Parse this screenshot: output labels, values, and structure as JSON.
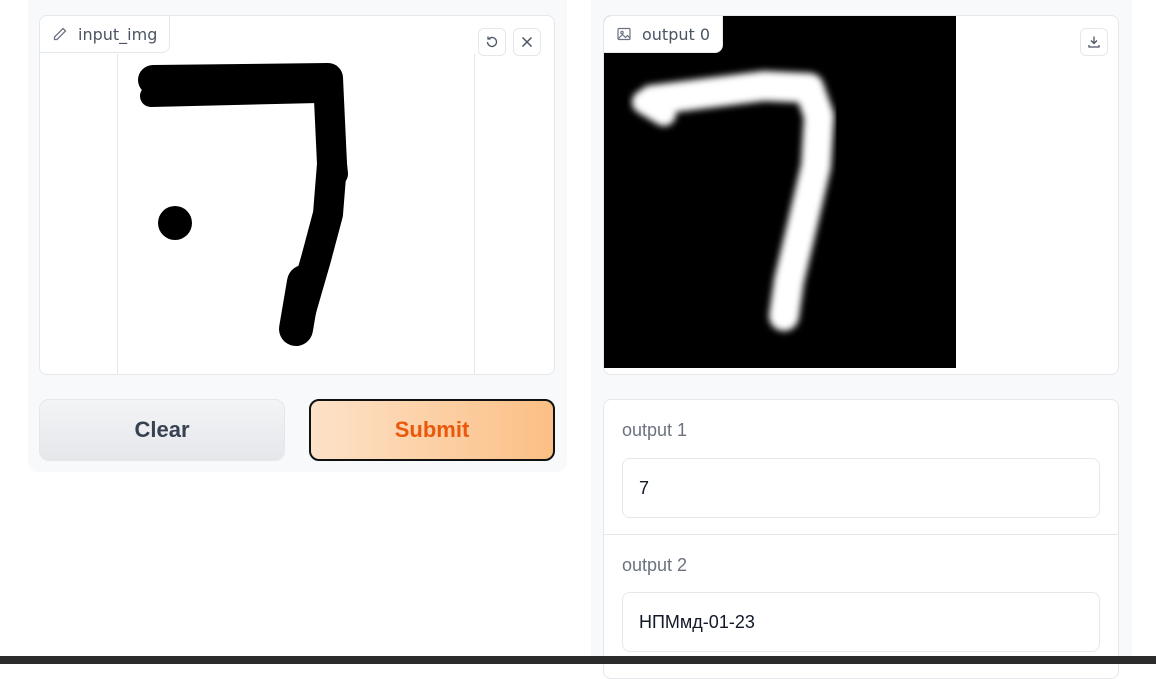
{
  "input_image": {
    "label": "input_img",
    "label_icon": "pencil-icon",
    "undo_icon": "undo-icon",
    "clear_icon": "close-icon"
  },
  "output0": {
    "label": "output 0",
    "label_icon": "image-icon",
    "download_icon": "download-icon"
  },
  "buttons": {
    "clear": "Clear",
    "submit": "Submit"
  },
  "output1": {
    "label": "output 1",
    "value": "7"
  },
  "output2": {
    "label": "output 2",
    "value": "НПМмд-01-23"
  },
  "colors": {
    "submit_text": "#ea580c",
    "submit_gradient_start": "#fde2c8",
    "submit_gradient_end": "#fbbf84"
  }
}
